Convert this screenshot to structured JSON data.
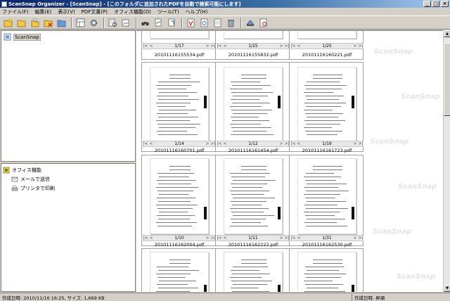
{
  "window": {
    "title": "ScanSnap Organizer - [ScanSnap] - [このフォルダに追加されたPDFを自動で検索可能にします]",
    "controls": [
      "_",
      "□",
      "×"
    ]
  },
  "menu": [
    "ファイル(F)",
    "編集(E)",
    "表示(V)",
    "PDF文書(P)",
    "オフィス機能(O)",
    "ツール(T)",
    "ヘルプ(H)"
  ],
  "toolbar": {
    "icons": [
      "folder-new-icon",
      "folder-open-icon",
      "folder-copy-icon",
      "folder-delete-icon",
      "folder-up-icon",
      "layout-icon",
      "gear-icon",
      "search-text-icon",
      "search-image-icon",
      "binoculars-icon",
      "rotate-icon",
      "refresh-icon",
      "pdf-icon",
      "stamp-icon",
      "document-icon",
      "trash-icon",
      "scan-icon",
      "viewer-icon"
    ]
  },
  "tree": {
    "root_label": "ScanSnap"
  },
  "apps": {
    "group_label": "オフィス機能",
    "items": [
      "メールで送信",
      "プリンタで印刷"
    ]
  },
  "watermark_text": "ScanSnap",
  "thumbnails": [
    {
      "page": "1/17",
      "file": "20101116155534.pdf",
      "heading": ""
    },
    {
      "page": "1/25",
      "file": "20101116155832.pdf",
      "heading": ""
    },
    {
      "page": "1/25",
      "file": "20101116160221.pdf",
      "heading": ""
    },
    {
      "page": "1/14",
      "file": "20101116160701.pdf",
      "heading": "開示書類"
    },
    {
      "page": "1/12",
      "file": "20101116161454.pdf",
      "heading": "ネットワーク・データ概要"
    },
    {
      "page": "1/19",
      "file": "20101116161723.pdf",
      "heading": "国庫2年度 国際事業計画"
    },
    {
      "page": "1/10",
      "file": "20101116162004.pdf",
      "heading": "新規事業"
    },
    {
      "page": "1/11",
      "file": "20101116162222.pdf",
      "heading": "人事資料"
    },
    {
      "page": "1/31",
      "file": "20101116162530.pdf",
      "heading": "法人事業所"
    },
    {
      "page": "",
      "file": "",
      "heading": "事業概要"
    },
    {
      "page": "",
      "file": "",
      "heading": "レーダ"
    },
    {
      "page": "",
      "file": "",
      "heading": "仕様"
    }
  ],
  "status": {
    "left": "作成日時: 2010/11/16 16:25, サイズ: 1,669 KB",
    "right": "作成日時, 昇順"
  }
}
